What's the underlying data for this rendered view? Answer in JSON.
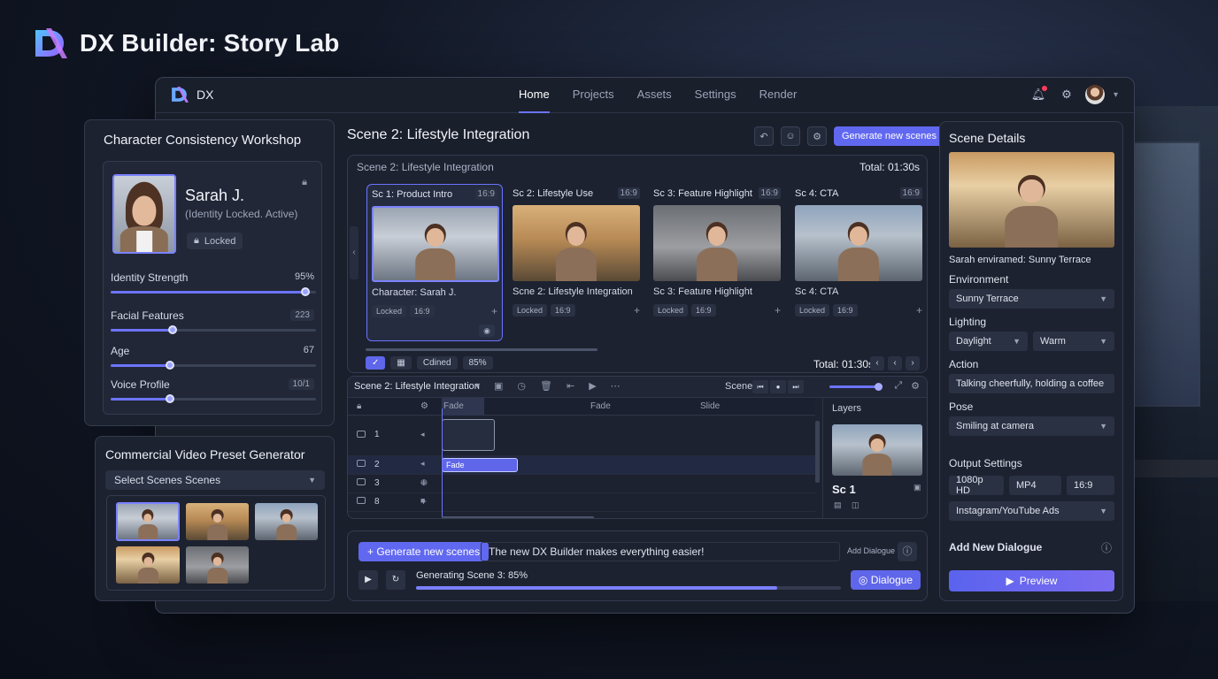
{
  "brand": {
    "title": "DX Builder: Story Lab",
    "app_short": "DX"
  },
  "nav": {
    "items": [
      "Home",
      "Projects",
      "Assets",
      "Settings",
      "Render"
    ],
    "active": "Home"
  },
  "character": {
    "panel_title": "Character Consistency Workshop",
    "name": "Sarah J.",
    "status": "(Identity Locked. Active)",
    "lock_label": "Locked",
    "sliders": [
      {
        "label": "Identity Strength",
        "value": "95%",
        "level": 0.95
      },
      {
        "label": "Facial Features",
        "value": "223",
        "level": 0.3
      },
      {
        "label": "Age",
        "value": "67",
        "level": 0.29
      },
      {
        "label": "Voice Profile",
        "value": "10/1",
        "level": 0.29
      }
    ]
  },
  "preset": {
    "panel_title": "Commercial Video Preset Generator",
    "select_value": "Select Scenes Scenes"
  },
  "scene": {
    "title": "Scene 2: Lifestyle Integration",
    "generate_label": "Generate new scenes",
    "strip_label": "Scene 2: Lifestyle Integration",
    "total": "Total: 01:30s",
    "cards": [
      {
        "title": "Sc 1: Product Intro",
        "ratio": "16:9",
        "caption": "Character: Sarah J.",
        "tags": [
          "Locked",
          "16:9"
        ]
      },
      {
        "title": "Sc 2: Lifestyle Use",
        "ratio": "16:9",
        "caption": "Scne 2: Lifestyle Integration",
        "tags": [
          "Locked",
          "16:9"
        ]
      },
      {
        "title": "Sc 3: Feature Highlight",
        "ratio": "16:9",
        "caption": "Sc 3: Feature Highlight",
        "tags": [
          "Locked",
          "16:9"
        ]
      },
      {
        "title": "Sc 4: CTA",
        "ratio": "16:9",
        "caption": "Sc 4: CTA",
        "tags": [
          "Locked",
          "16:9"
        ]
      }
    ],
    "bottom_tags": [
      "Cdined",
      "85%"
    ],
    "total2": "Total: 01:30s"
  },
  "timeline": {
    "title": "Scene 2: Lifestyle Integration",
    "scene_label": "Scene",
    "ruler": [
      "Fade",
      "Fade",
      "Slide"
    ],
    "tracks": [
      "1",
      "2",
      "3",
      "8"
    ],
    "clip_label": "Fade",
    "layers_title": "Layers",
    "layer_name": "Sc 1"
  },
  "dialogue": {
    "generate_label": "Generate new scenes",
    "input_value": "The new DX Builder makes everything easier!",
    "add_label": "Add Dialogue",
    "progress_text": "Generating Scene 3: 85%",
    "progress": 0.85,
    "dialogue_button": "Dialogue"
  },
  "details": {
    "title": "Scene Details",
    "caption": "Sarah enviramed: Sunny Terrace",
    "environment_label": "Environment",
    "environment": "Sunny Terrace",
    "lighting_label": "Lighting",
    "lighting_a": "Daylight",
    "lighting_b": "Warm",
    "action_label": "Action",
    "action": "Talking cheerfully, holding a coffee",
    "pose_label": "Pose",
    "pose": "Smiling at camera",
    "output_label": "Output Settings",
    "resolution": "1080p HD",
    "format": "MP4",
    "ratio": "16:9",
    "platform": "Instagram/YouTube Ads",
    "add_dialogue_label": "Add New Dialogue",
    "preview_label": "Preview"
  },
  "colors": {
    "accent": "#6168f0",
    "background": "#121826",
    "panel": "#1d2230"
  }
}
